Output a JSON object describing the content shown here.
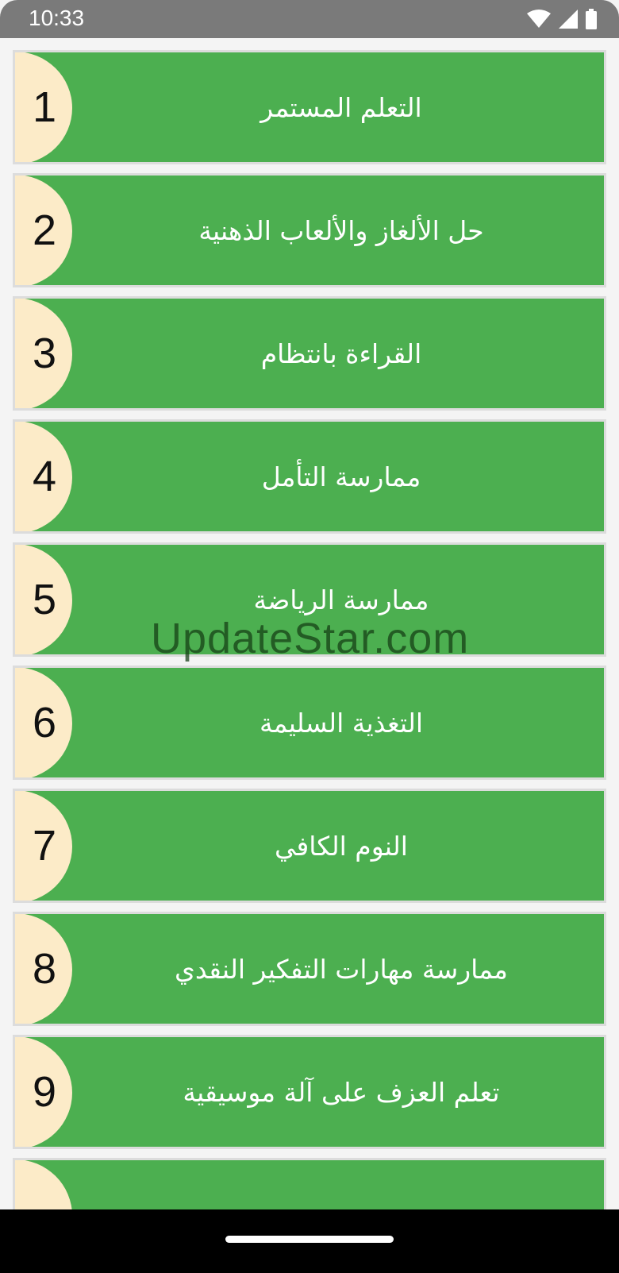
{
  "status_bar": {
    "time": "10:33",
    "icons": [
      "wifi-icon",
      "signal-icon",
      "battery-icon"
    ]
  },
  "items": [
    {
      "number": "1",
      "label": "التعلم المستمر"
    },
    {
      "number": "2",
      "label": "حل الألغاز والألعاب الذهنية"
    },
    {
      "number": "3",
      "label": "القراءة بانتظام"
    },
    {
      "number": "4",
      "label": "ممارسة التأمل"
    },
    {
      "number": "5",
      "label": "ممارسة الرياضة"
    },
    {
      "number": "6",
      "label": "التغذية السليمة"
    },
    {
      "number": "7",
      "label": "النوم الكافي"
    },
    {
      "number": "8",
      "label": "ممارسة مهارات التفكير النقدي"
    },
    {
      "number": "9",
      "label": "تعلم العزف على آلة موسيقية"
    },
    {
      "number": "",
      "label": ""
    }
  ],
  "watermark": "UpdateStar.com",
  "colors": {
    "item_background": "#4caf50",
    "number_circle": "#fcebc8",
    "status_bar": "#7a7a7a"
  }
}
